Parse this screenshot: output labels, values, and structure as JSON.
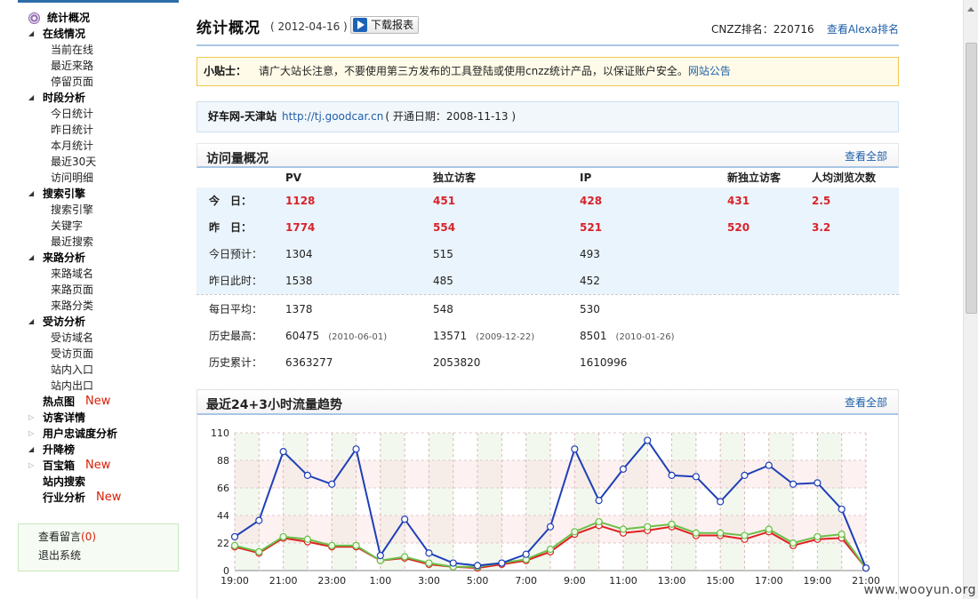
{
  "sidebar": {
    "home_label": "统计概况",
    "groups": [
      {
        "label": "在线情况",
        "open": true,
        "items": [
          "当前在线",
          "最近来路",
          "停留页面"
        ]
      },
      {
        "label": "时段分析",
        "open": true,
        "items": [
          "今日统计",
          "昨日统计",
          "本月统计",
          "最近30天",
          "访问明细"
        ]
      },
      {
        "label": "搜索引擎",
        "open": true,
        "items": [
          "搜索引擎",
          "关键字",
          "最近搜索"
        ]
      },
      {
        "label": "来路分析",
        "open": true,
        "items": [
          "来路域名",
          "来路页面",
          "来路分类"
        ]
      },
      {
        "label": "受访分析",
        "open": true,
        "items": [
          "受访域名",
          "受访页面",
          "站内入口",
          "站内出口"
        ]
      }
    ],
    "extra_items": [
      {
        "label": "热点图",
        "tri": "",
        "badge": "New"
      },
      {
        "label": "访客详情",
        "tri": "closed",
        "badge": ""
      },
      {
        "label": "用户忠诚度分析",
        "tri": "closed",
        "badge": ""
      },
      {
        "label": "升降榜",
        "tri": "open",
        "badge": ""
      },
      {
        "label": "百宝箱",
        "tri": "closed",
        "badge": "New"
      },
      {
        "label": "站内搜索",
        "tri": "",
        "badge": ""
      },
      {
        "label": "行业分析",
        "tri": "",
        "badge": "New"
      }
    ],
    "messages_label": "查看留言",
    "messages_count": "(0)",
    "logout_label": "退出系统"
  },
  "header": {
    "title": "统计概况",
    "date": "( 2012-04-16 )",
    "download_label": "下载报表",
    "rank": "CNZZ排名：220716",
    "alexa_link": "查看Alexa排名"
  },
  "tip": {
    "label": "小贴士：",
    "text": "请广大站长注意，不要使用第三方发布的工具登陆或使用cnzz统计产品，以保证账户安全。",
    "link": "网站公告"
  },
  "site": {
    "name": "好车网-天津站",
    "url": "http://tj.goodcar.cn",
    "opened": "( 开通日期：2008-11-13 )"
  },
  "overview": {
    "title": "访问量概况",
    "more": "查看全部",
    "columns": [
      "PV",
      "独立访客",
      "IP",
      "新独立访客",
      "人均浏览次数"
    ],
    "rows_top": [
      {
        "label": "今　日：",
        "strong": true,
        "values": [
          "1128",
          "451",
          "428",
          "431",
          "2.5"
        ]
      },
      {
        "label": "昨　日：",
        "strong": true,
        "values": [
          "1774",
          "554",
          "521",
          "520",
          "3.2"
        ]
      },
      {
        "label": "今日预计：",
        "strong": false,
        "values": [
          "1304",
          "515",
          "493",
          "",
          ""
        ]
      },
      {
        "label": "昨日此时：",
        "strong": false,
        "values": [
          "1538",
          "485",
          "452",
          "",
          ""
        ]
      }
    ],
    "rows_bottom": [
      {
        "label": "每日平均：",
        "values": [
          "1378",
          "548",
          "530"
        ],
        "dates": [
          "",
          "",
          ""
        ]
      },
      {
        "label": "历史最高：",
        "values": [
          "60475",
          "13571",
          "8501"
        ],
        "dates": [
          "(2010-06-01)",
          "(2009-12-22)",
          "(2010-01-26)"
        ]
      },
      {
        "label": "历史累计：",
        "values": [
          "6363277",
          "2053820",
          "1610996"
        ],
        "dates": [
          "",
          "",
          ""
        ]
      }
    ]
  },
  "trend": {
    "title": "最近24+3小时流量趋势",
    "more": "查看全部"
  },
  "chart_data": {
    "type": "line",
    "title": "最近24+3小时流量趋势",
    "xlabel": "",
    "ylabel": "",
    "ylim": [
      0,
      110
    ],
    "yticks": [
      0,
      22,
      44,
      66,
      88,
      110
    ],
    "x_tick_labels": [
      "19:00",
      "21:00",
      "23:00",
      "1:00",
      "3:00",
      "5:00",
      "7:00",
      "9:00",
      "11:00",
      "13:00",
      "15:00",
      "17:00",
      "19:00",
      "21:00"
    ],
    "grid": true,
    "series": [
      {
        "color": "#1f3fb8",
        "values": [
          27,
          40,
          95,
          76,
          69,
          97,
          12,
          41,
          14,
          6,
          4,
          6,
          13,
          35,
          97,
          56,
          81,
          104,
          76,
          75,
          55,
          76,
          84,
          69,
          70,
          49,
          2
        ]
      },
      {
        "color": "#e02020",
        "values": [
          19,
          14,
          26,
          23,
          19,
          19,
          8,
          10,
          5,
          3,
          2,
          5,
          8,
          15,
          29,
          36,
          30,
          32,
          35,
          28,
          28,
          25,
          31,
          20,
          25,
          26,
          2
        ]
      },
      {
        "color": "#6ac04a",
        "values": [
          20,
          15,
          27,
          25,
          20,
          20,
          8,
          11,
          6,
          3,
          3,
          6,
          9,
          17,
          31,
          39,
          33,
          35,
          37,
          30,
          30,
          28,
          33,
          22,
          27,
          29,
          2
        ]
      }
    ]
  },
  "colors": {
    "accent": "#2c6ca8",
    "link": "#1f5fa8",
    "highlight_value": "#d8232a",
    "new_badge": "#d81e06"
  },
  "watermark": "www.wooyun.org"
}
